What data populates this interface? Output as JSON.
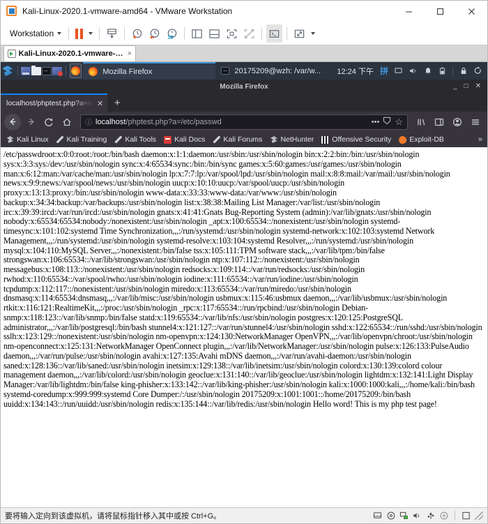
{
  "vmware": {
    "title": "Kali-Linux-2020.1-vmware-amd64 - VMware Workstation",
    "window_controls": {
      "minimize": "minimize-icon",
      "maximize": "maximize-icon",
      "close": "close-icon"
    },
    "toolbar": {
      "menu_label": "Workstation",
      "items": [
        "pause-vm-button",
        "pause-dropdown-caret",
        "send-ctrl-alt-del-button",
        "snapshot-button",
        "revert-snapshot-button",
        "snapshot-manager-button",
        "show-library-button",
        "show-thumbnails-button",
        "full-screen-button",
        "unity-mode-button",
        "console-view-button",
        "stretch-view-button",
        "stretch-dropdown-caret"
      ]
    },
    "tab": {
      "label": "Kali-Linux-2020.1-vmware-a...",
      "close_label": "×"
    },
    "statusbar": {
      "message": "要将输入定向到该虚拟机，请将鼠标指针移入其中或按 Ctrl+G。",
      "icons": [
        "hard-disk-icon",
        "cd-dvd-icon",
        "network-adapter-icon",
        "sound-card-icon",
        "usb-device-icon",
        "printer-icon",
        "display-icon"
      ]
    }
  },
  "kali_panel": {
    "launcher": "kali-dragon-menu-icon",
    "quick_launch": [
      "file-manager-icon",
      "folder-icon",
      "terminal-icon",
      "app-icon"
    ],
    "active_launcher": "firefox-icon",
    "tasks": [
      {
        "icon": "firefox-icon",
        "label": "Mozilla Firefox"
      },
      {
        "icon": "terminal-icon",
        "label": "20175209@wzh: /var/w..."
      }
    ],
    "clock": "12:24 下午",
    "ime": "拼",
    "tray": [
      "display-icon",
      "volume-icon",
      "notification-bell-icon",
      "battery-icon",
      "lock-icon",
      "power-icon"
    ]
  },
  "firefox": {
    "window_title": "Mozilla Firefox",
    "window_controls": {
      "minimize": "_",
      "maximize": "□",
      "close": "✕"
    },
    "tab": {
      "label": "localhost/phptest.php?a=/etc/passwd",
      "close": "✕"
    },
    "new_tab_label": "+",
    "nav": {
      "back": "back-arrow-icon",
      "forward": "forward-arrow-icon",
      "reload": "reload-icon",
      "home": "home-icon",
      "library": "library-icon",
      "sidebar": "sidebar-icon",
      "account": "account-icon",
      "menu": "hamburger-menu-icon"
    },
    "urlbar": {
      "info_icon": "ⓘ",
      "host": "localhost",
      "path": "/phptest.php?a=/etc/passwd",
      "page_actions": "•••",
      "reader_icon": "reader-mode-icon",
      "bookmark_icon": "☆"
    },
    "bookmarks": [
      {
        "label": "Kali Linux",
        "icon": "kali-dragon-icon"
      },
      {
        "label": "Kali Training",
        "icon": "kali-slash-icon"
      },
      {
        "label": "Kali Tools",
        "icon": "kali-slash-icon"
      },
      {
        "label": "Kali Docs",
        "icon": "kali-docs-icon"
      },
      {
        "label": "Kali Forums",
        "icon": "kali-slash-icon"
      },
      {
        "label": "NetHunter",
        "icon": "nethunter-icon"
      },
      {
        "label": "Offensive Security",
        "icon": "offensive-security-icon"
      },
      {
        "label": "Exploit-DB",
        "icon": "exploit-db-icon"
      }
    ],
    "bookmarks_overflow": "»"
  },
  "page": {
    "body_text": "/etc/passwdroot:x:0:0:root:/root:/bin/bash daemon:x:1:1:daemon:/usr/sbin:/usr/sbin/nologin bin:x:2:2:bin:/bin:/usr/sbin/nologin sys:x:3:3:sys:/dev:/usr/sbin/nologin sync:x:4:65534:sync:/bin:/bin/sync games:x:5:60:games:/usr/games:/usr/sbin/nologin man:x:6:12:man:/var/cache/man:/usr/sbin/nologin lp:x:7:7:lp:/var/spool/lpd:/usr/sbin/nologin mail:x:8:8:mail:/var/mail:/usr/sbin/nologin news:x:9:9:news:/var/spool/news:/usr/sbin/nologin uucp:x:10:10:uucp:/var/spool/uucp:/usr/sbin/nologin proxy:x:13:13:proxy:/bin:/usr/sbin/nologin www-data:x:33:33:www-data:/var/www:/usr/sbin/nologin backup:x:34:34:backup:/var/backups:/usr/sbin/nologin list:x:38:38:Mailing List Manager:/var/list:/usr/sbin/nologin irc:x:39:39:ircd:/var/run/ircd:/usr/sbin/nologin gnats:x:41:41:Gnats Bug-Reporting System (admin):/var/lib/gnats:/usr/sbin/nologin nobody:x:65534:65534:nobody:/nonexistent:/usr/sbin/nologin _apt:x:100:65534::/nonexistent:/usr/sbin/nologin systemd-timesync:x:101:102:systemd Time Synchronization,,,:/run/systemd:/usr/sbin/nologin systemd-network:x:102:103:systemd Network Management,,,:/run/systemd:/usr/sbin/nologin systemd-resolve:x:103:104:systemd Resolver,,,:/run/systemd:/usr/sbin/nologin mysql:x:104:110:MySQL Server,,,:/nonexistent:/bin/false tss:x:105:111:TPM software stack,,,:/var/lib/tpm:/bin/false strongswan:x:106:65534::/var/lib/strongswan:/usr/sbin/nologin ntp:x:107:112::/nonexistent:/usr/sbin/nologin messagebus:x:108:113::/nonexistent:/usr/sbin/nologin redsocks:x:109:114::/var/run/redsocks:/usr/sbin/nologin rwhod:x:110:65534::/var/spool/rwho:/usr/sbin/nologin iodine:x:111:65534::/var/run/iodine:/usr/sbin/nologin tcpdump:x:112:117::/nonexistent:/usr/sbin/nologin miredo:x:113:65534::/var/run/miredo:/usr/sbin/nologin dnsmasq:x:114:65534:dnsmasq,,,:/var/lib/misc:/usr/sbin/nologin usbmux:x:115:46:usbmux daemon,,,:/var/lib/usbmux:/usr/sbin/nologin rtkit:x:116:121:RealtimeKit,,,:/proc:/usr/sbin/nologin _rpc:x:117:65534::/run/rpcbind:/usr/sbin/nologin Debian-snmp:x:118:123::/var/lib/snmp:/bin/false statd:x:119:65534::/var/lib/nfs:/usr/sbin/nologin postgres:x:120:125:PostgreSQL administrator,,,:/var/lib/postgresql:/bin/bash stunnel4:x:121:127::/var/run/stunnel4:/usr/sbin/nologin sshd:x:122:65534::/run/sshd:/usr/sbin/nologin sslh:x:123:129::/nonexistent:/usr/sbin/nologin nm-openvpn:x:124:130:NetworkManager OpenVPN,,,:/var/lib/openvpn/chroot:/usr/sbin/nologin nm-openconnect:x:125:131:NetworkManager OpenConnect plugin,,,:/var/lib/NetworkManager:/usr/sbin/nologin pulse:x:126:133:PulseAudio daemon,,,:/var/run/pulse:/usr/sbin/nologin avahi:x:127:135:Avahi mDNS daemon,,,:/var/run/avahi-daemon:/usr/sbin/nologin saned:x:128:136::/var/lib/saned:/usr/sbin/nologin inetsim:x:129:138::/var/lib/inetsim:/usr/sbin/nologin colord:x:130:139:colord colour management daemon,,,:/var/lib/colord:/usr/sbin/nologin geoclue:x:131:140::/var/lib/geoclue:/usr/sbin/nologin lightdm:x:132:141:Light Display Manager:/var/lib/lightdm:/bin/false king-phisher:x:133:142::/var/lib/king-phisher:/usr/sbin/nologin kali:x:1000:1000:kali,,,:/home/kali:/bin/bash systemd-coredump:x:999:999:systemd Core Dumper:/:/usr/sbin/nologin 20175209:x:1001:1001::/home/20175209:/bin/bash uuidd:x:134:143::/run/uuidd:/usr/sbin/nologin redis:x:135:144::/var/lib/redis:/usr/sbin/nologin Hello word! This is my php test page!"
  },
  "colors": {
    "vmware_orange": "#e8531f",
    "firefox_tab_accent": "#0a84ff",
    "kali_panel": "#2b333f",
    "kali_task_accent": "#3f95d8",
    "firefox_chrome": "#38343c"
  }
}
